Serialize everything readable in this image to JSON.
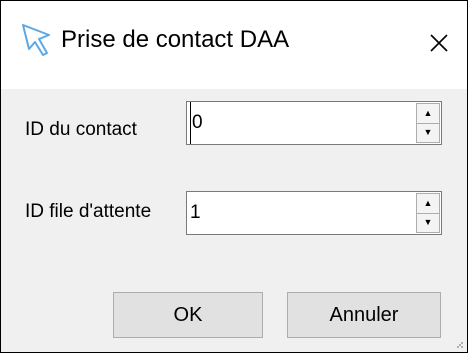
{
  "window": {
    "title": "Prise de contact DAA",
    "title_icon": "cursor-arrow-icon",
    "close_icon": "close-icon",
    "accent_color": "#5aa9e6"
  },
  "fields": [
    {
      "label": "ID du contact",
      "value": "0"
    },
    {
      "label": "ID file d'attente",
      "value": "1"
    }
  ],
  "spin_icons": {
    "up": "spin-up-icon",
    "down": "spin-down-icon"
  },
  "buttons": {
    "ok_label": "OK",
    "cancel_label": "Annuler"
  }
}
